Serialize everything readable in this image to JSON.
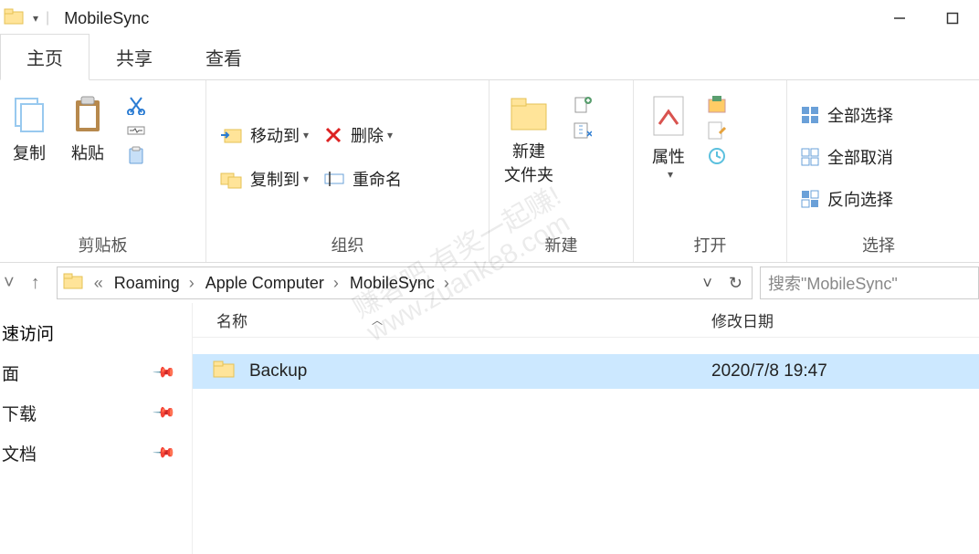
{
  "window": {
    "title": "MobileSync"
  },
  "tabs": {
    "home": "主页",
    "share": "共享",
    "view": "查看"
  },
  "ribbon": {
    "clipboard": {
      "label": "剪贴板",
      "copy": "复制",
      "paste": "粘贴"
    },
    "organize": {
      "label": "组织",
      "move_to": "移动到",
      "copy_to": "复制到",
      "delete": "删除",
      "rename": "重命名"
    },
    "new": {
      "label": "新建",
      "new_folder": "新建\n文件夹"
    },
    "open": {
      "label": "打开",
      "properties": "属性"
    },
    "select": {
      "label": "选择",
      "select_all": "全部选择",
      "select_none": "全部取消",
      "invert": "反向选择"
    }
  },
  "breadcrumb": {
    "seg1": "Roaming",
    "seg2": "Apple Computer",
    "seg3": "MobileSync"
  },
  "search": {
    "placeholder": "搜索\"MobileSync\""
  },
  "sidebar": {
    "quick_access": "速访问",
    "desktop": "面",
    "downloads": "下载",
    "documents": "文档"
  },
  "columns": {
    "name": "名称",
    "modified": "修改日期"
  },
  "files": [
    {
      "name": "Backup",
      "modified": "2020/7/8 19:47"
    }
  ],
  "watermark": {
    "line1": "赚客吧 有奖一起赚!",
    "line2": "www.zuanke8.com"
  }
}
